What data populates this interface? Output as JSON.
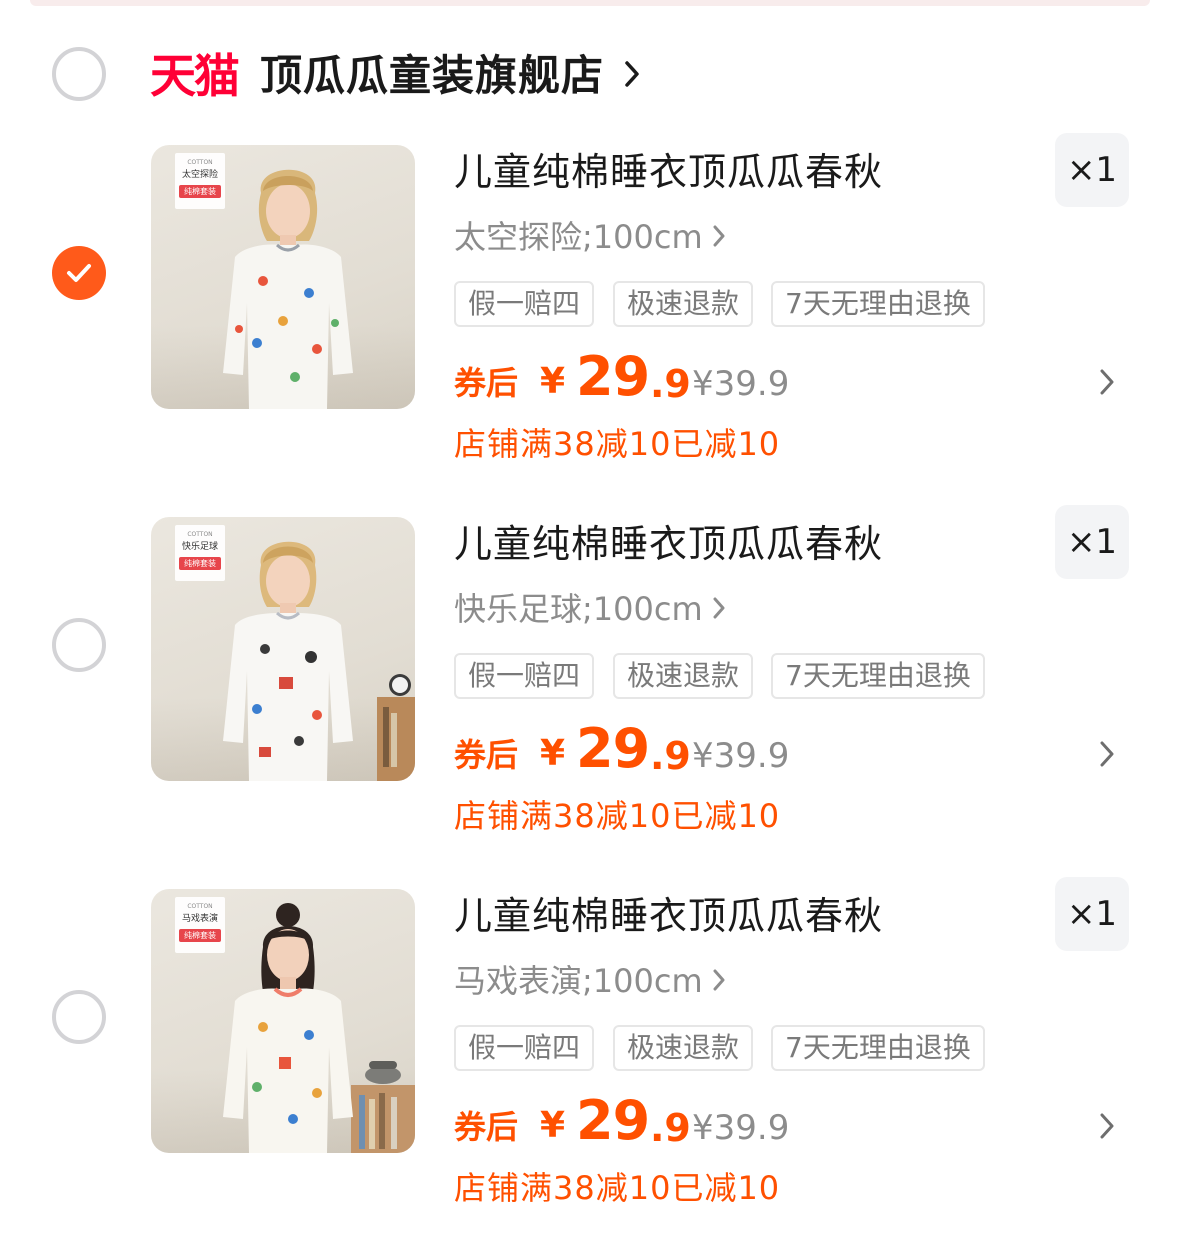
{
  "store": {
    "platform_logo_text": "天猫",
    "name": "顶瓜瓜童装旗舰店",
    "selected": false
  },
  "colors": {
    "accent": "#ff5000",
    "tmall_red": "#ff0036",
    "checked_radio": "#ff5a1a"
  },
  "items": [
    {
      "selected": true,
      "badge_cotton": "COTTON",
      "badge_theme": "太空探险",
      "badge_set": "纯棉套装",
      "title": "儿童纯棉睡衣顶瓜瓜春秋",
      "quantity": "×1",
      "sku": "太空探险;100cm",
      "tags": [
        "假一赔四",
        "极速退款",
        "7天无理由退换"
      ],
      "coupon_label": "券后",
      "currency": "¥",
      "price_int": "29",
      "price_dec": ".9",
      "original_price": "¥39.9",
      "promo": "店铺满38减10已减10"
    },
    {
      "selected": false,
      "badge_cotton": "COTTON",
      "badge_theme": "快乐足球",
      "badge_set": "纯棉套装",
      "title": "儿童纯棉睡衣顶瓜瓜春秋",
      "quantity": "×1",
      "sku": "快乐足球;100cm",
      "tags": [
        "假一赔四",
        "极速退款",
        "7天无理由退换"
      ],
      "coupon_label": "券后",
      "currency": "¥",
      "price_int": "29",
      "price_dec": ".9",
      "original_price": "¥39.9",
      "promo": "店铺满38减10已减10"
    },
    {
      "selected": false,
      "badge_cotton": "COTTON",
      "badge_theme": "马戏表演",
      "badge_set": "纯棉套装",
      "title": "儿童纯棉睡衣顶瓜瓜春秋",
      "quantity": "×1",
      "sku": "马戏表演;100cm",
      "tags": [
        "假一赔四",
        "极速退款",
        "7天无理由退换"
      ],
      "coupon_label": "券后",
      "currency": "¥",
      "price_int": "29",
      "price_dec": ".9",
      "original_price": "¥39.9",
      "promo": "店铺满38减10已减10"
    }
  ]
}
